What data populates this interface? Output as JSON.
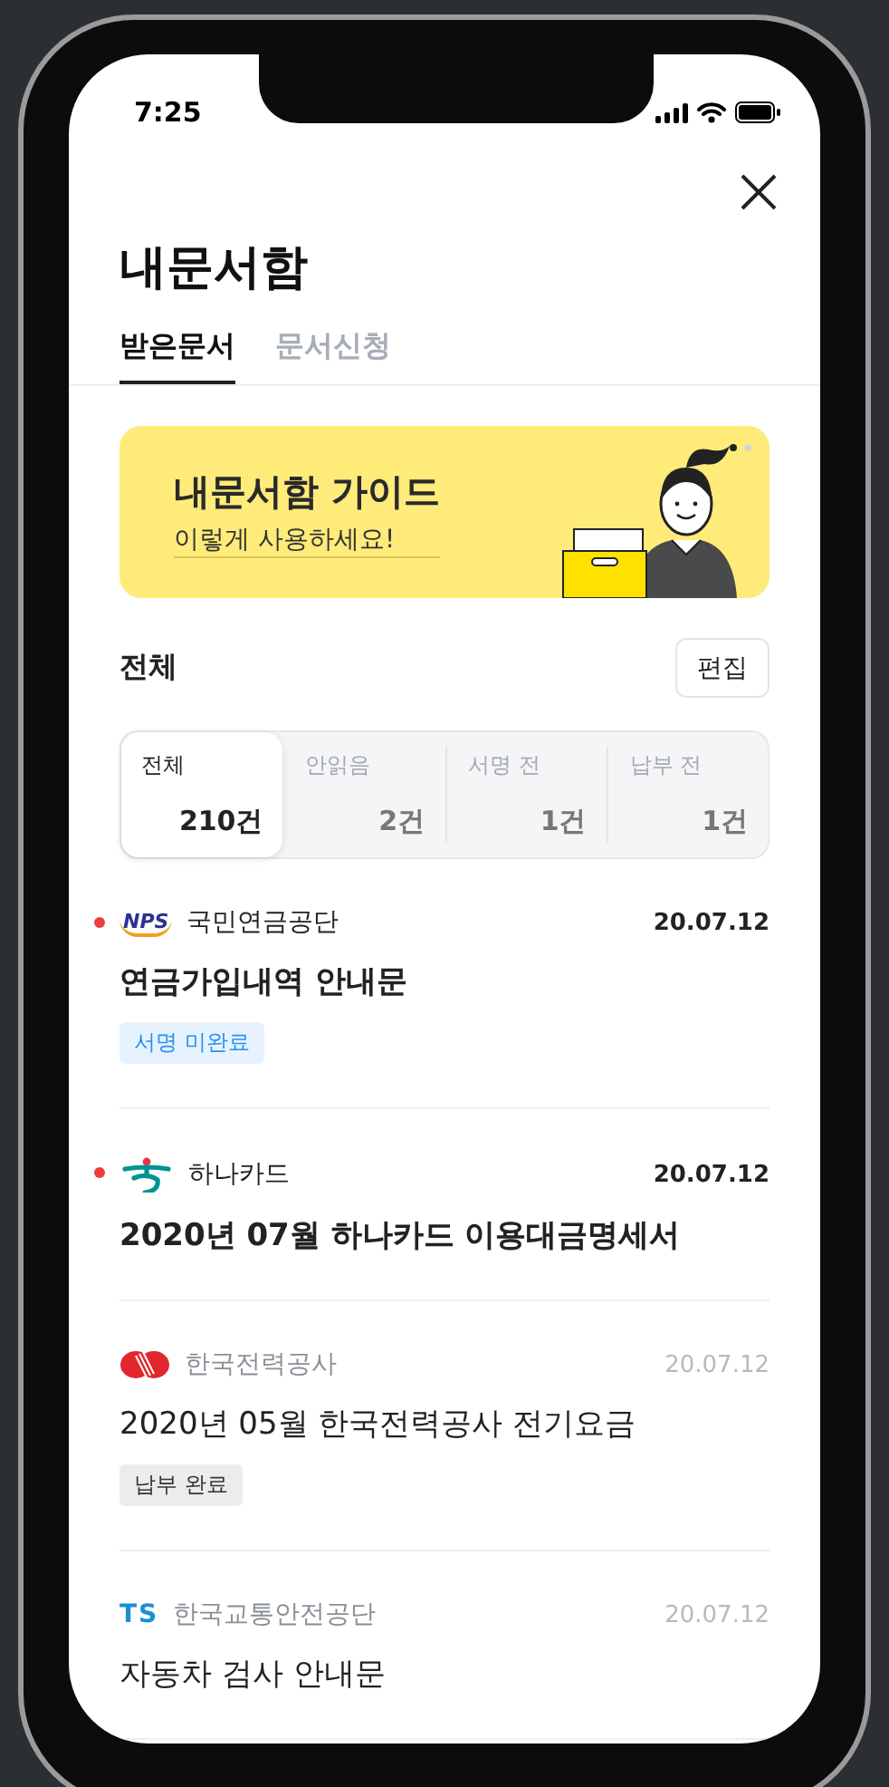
{
  "status_bar": {
    "time": "7:25"
  },
  "header": {
    "title": "내문서함"
  },
  "tabs": [
    {
      "label": "받은문서",
      "selected": true
    },
    {
      "label": "문서신청",
      "selected": false
    }
  ],
  "banner": {
    "title": "내문서함 가이드",
    "subtitle": "이렇게 사용하세요!",
    "pages": [
      {
        "selected": true
      },
      {
        "selected": false
      }
    ]
  },
  "section": {
    "title": "전체",
    "edit_button": "편집"
  },
  "filters": [
    {
      "label": "전체",
      "count": "210건",
      "selected": true
    },
    {
      "label": "안읽음",
      "count": "2건",
      "selected": false
    },
    {
      "label": "서명 전",
      "count": "1건",
      "selected": false
    },
    {
      "label": "납부 전",
      "count": "1건",
      "selected": false
    }
  ],
  "documents": [
    {
      "kind": "nps",
      "logo_text": "NPS",
      "sender": "국민연금공단",
      "date": "20.07.12",
      "title": "연금가입내역 안내문",
      "unread": true,
      "tag": {
        "kind": "pending",
        "label": "서명 미완료"
      }
    },
    {
      "kind": "hana",
      "sender": "하나카드",
      "date": "20.07.12",
      "title": "2020년 07월 하나카드 이용대금명세서",
      "unread": true
    },
    {
      "kind": "kepco",
      "sender": "한국전력공사",
      "date": "20.07.12",
      "title": "2020년 05월 한국전력공사 전기요금",
      "unread": false,
      "tag": {
        "kind": "done",
        "label": "납부 완료"
      }
    },
    {
      "kind": "ts",
      "logo_text": "TS",
      "sender": "한국교통안전공단",
      "date": "20.07.12",
      "title": "자동차 검사 안내문",
      "unread": false
    }
  ]
}
